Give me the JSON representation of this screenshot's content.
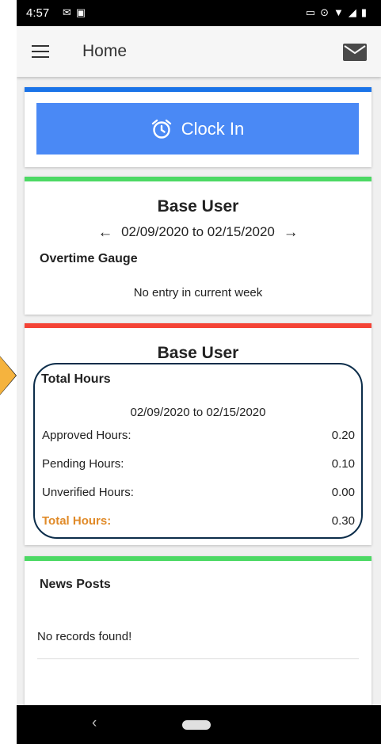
{
  "status_bar": {
    "time": "4:57",
    "left_icons": [
      "gmail-icon",
      "notification-icon"
    ],
    "right_icons": [
      "cast-icon",
      "location-icon",
      "wifi-icon",
      "signal-icon",
      "battery-icon"
    ]
  },
  "app_bar": {
    "title": "Home"
  },
  "clock_card": {
    "button_label": "Clock In",
    "accent_color": "#1a73e8",
    "button_color": "#4a89f5"
  },
  "overtime_card": {
    "user_name": "Base User",
    "date_range": "02/09/2020 to 02/15/2020",
    "section_title": "Overtime Gauge",
    "message": "No entry in current week",
    "accent_color": "#4cd964"
  },
  "hours_card": {
    "user_name": "Base User",
    "section_title": "Total Hours",
    "date_range": "02/09/2020 to 02/15/2020",
    "accent_color": "#f44336",
    "rows": [
      {
        "label": "Approved Hours:",
        "value": "0.20"
      },
      {
        "label": "Pending Hours:",
        "value": "0.10"
      },
      {
        "label": "Unverified Hours:",
        "value": "0.00"
      },
      {
        "label": "Total Hours:",
        "value": "0.30"
      }
    ],
    "total_label_color": "#e08a28"
  },
  "news_card": {
    "title": "News Posts",
    "message": "No records found!",
    "accent_color": "#4cd964"
  },
  "nav_bar": {
    "back_glyph": "‹"
  }
}
